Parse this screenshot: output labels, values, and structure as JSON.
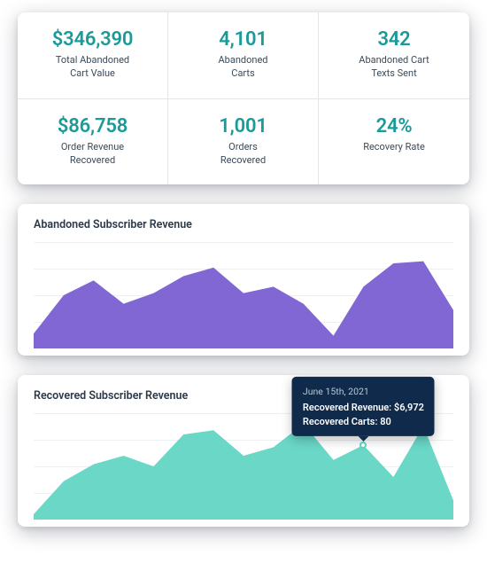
{
  "metrics": [
    {
      "value": "$346,390",
      "label": "Total Abandoned\nCart Value"
    },
    {
      "value": "4,101",
      "label": "Abandoned\nCarts"
    },
    {
      "value": "342",
      "label": "Abandoned Cart\nTexts Sent"
    },
    {
      "value": "$86,758",
      "label": "Order Revenue\nRecovered"
    },
    {
      "value": "1,001",
      "label": "Orders\nRecovered"
    },
    {
      "value": "24%",
      "label": "Recovery Rate"
    }
  ],
  "charts": {
    "abandoned": {
      "title": "Abandoned Subscriber Revenue",
      "color": "#7a5fd1"
    },
    "recovered": {
      "title": "Recovered Subscriber Revenue",
      "color": "#62d5c4"
    }
  },
  "tooltip": {
    "date": "June 15th, 2021",
    "line1": "Recovered Revenue: $6,972",
    "line2": "Recovered Carts: 80"
  },
  "chart_data": [
    {
      "type": "area",
      "title": "Abandoned Subscriber Revenue",
      "xlabel": "",
      "ylabel": "",
      "ylim": [
        0,
        100
      ],
      "x": [
        0,
        1,
        2,
        3,
        4,
        5,
        6,
        7,
        8,
        9,
        10,
        11,
        12,
        13,
        14
      ],
      "values": [
        14,
        50,
        64,
        42,
        52,
        68,
        76,
        52,
        58,
        42,
        12,
        58,
        80,
        82,
        36
      ],
      "color": "#7a5fd1"
    },
    {
      "type": "area",
      "title": "Recovered Subscriber Revenue",
      "xlabel": "",
      "ylabel": "",
      "ylim": [
        0,
        100
      ],
      "x": [
        0,
        1,
        2,
        3,
        4,
        5,
        6,
        7,
        8,
        9,
        10,
        11,
        12,
        13,
        14
      ],
      "values": [
        5,
        36,
        52,
        60,
        50,
        80,
        84,
        60,
        68,
        90,
        56,
        70,
        40,
        88,
        18
      ],
      "color": "#62d5c4",
      "hover_point": {
        "index": 11,
        "date": "June 15th, 2021",
        "recovered_revenue": 6972,
        "recovered_carts": 80
      }
    }
  ]
}
